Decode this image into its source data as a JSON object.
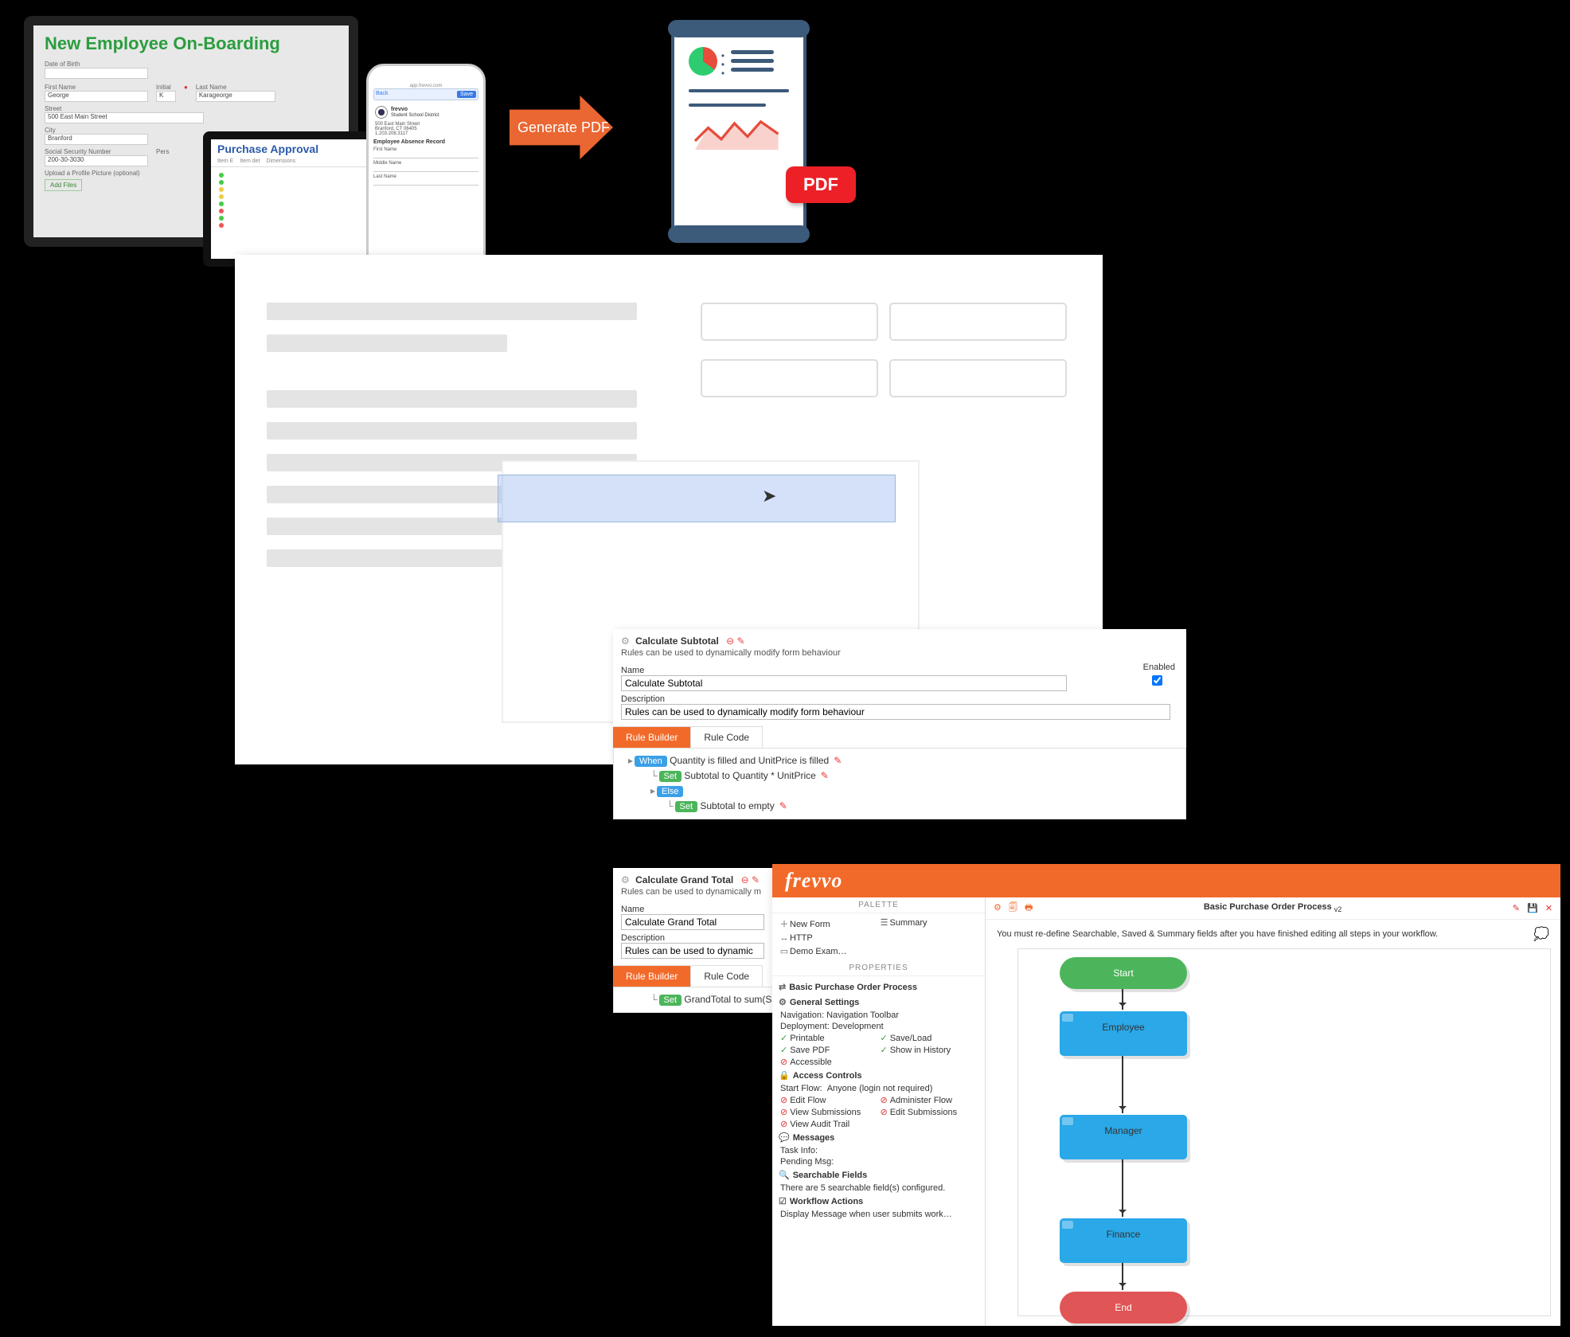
{
  "laptop": {
    "title": "New Employee On-Boarding",
    "dob_label": "Date of Birth",
    "first_name_label": "First Name",
    "first_name": "George",
    "initial_label": "Initial",
    "initial": "K",
    "last_name_label": "Last Name",
    "last_name": "Karageorge",
    "street_label": "Street",
    "street": "500 East Main Street",
    "city_label": "City",
    "city": "Branford",
    "ssn_label": "Social Security Number",
    "ssn": "200-30-3030",
    "pers_label": "Pers",
    "upload_label": "Upload a Profile Picture (optional)",
    "add_files": "Add Files"
  },
  "tablet": {
    "title": "Purchase Approval",
    "tabs": [
      "Item E",
      "Item det",
      "Dimensions"
    ]
  },
  "phone": {
    "back": "Back",
    "save": "Save",
    "url": "app.frevvo.com",
    "brand": "frevvo",
    "subtitle": "Student School District",
    "addr1": "500 East Main Street",
    "addr2": "Branford, CT 06405",
    "phonenum": "1.203.208.3117",
    "section": "Employee Absence Record",
    "fn": "First Name",
    "mn": "Middle Name",
    "ln": "Last Name"
  },
  "arrow_label": "Generate PDF",
  "pdf_badge": "PDF",
  "rule1": {
    "title": "Calculate Subtotal",
    "subtitle": "Rules can be used to dynamically modify form behaviour",
    "name_label": "Name",
    "name_value": "Calculate Subtotal",
    "desc_label": "Description",
    "desc_value": "Rules can be used to dynamically modify form behaviour",
    "enabled_label": "Enabled",
    "tab_builder": "Rule Builder",
    "tab_code": "Rule Code",
    "when_text": "Quantity is filled and UnitPrice is filled",
    "set1_text": "Subtotal to Quantity * UnitPrice",
    "else_text": "Else",
    "set2_text": "Subtotal to empty"
  },
  "rule2": {
    "title": "Calculate Grand Total",
    "subtitle": "Rules can be used to dynamically m",
    "name_label": "Name",
    "name_value": "Calculate Grand Total",
    "desc_label": "Description",
    "desc_value": "Rules can be used to dynamic",
    "tab_builder": "Rule Builder",
    "tab_code": "Rule Code",
    "set_text": "GrandTotal to sum(S"
  },
  "frevvo": {
    "logo": "frevvo",
    "palette_title": "PALETTE",
    "palette": {
      "new_form": "New Form",
      "summary": "Summary",
      "http": "HTTP",
      "demo": "Demo Exam…"
    },
    "properties_title": "PROPERTIES",
    "flow_name": "Basic Purchase Order Process",
    "general_settings": "General Settings",
    "nav_label": "Navigation:",
    "nav_value": "Navigation Toolbar",
    "deploy_label": "Deployment:",
    "deploy_value": "Development",
    "printable": "Printable",
    "saveload": "Save/Load",
    "savepdf": "Save PDF",
    "showhistory": "Show in History",
    "accessible": "Accessible",
    "access_controls": "Access Controls",
    "start_flow_label": "Start Flow:",
    "start_flow_value": "Anyone (login not required)",
    "edit_flow": "Edit Flow",
    "admin_flow": "Administer Flow",
    "view_subs": "View Submissions",
    "edit_subs": "Edit Submissions",
    "view_audit": "View Audit Trail",
    "messages": "Messages",
    "task_info": "Task Info:",
    "pending_msg": "Pending Msg:",
    "searchable": "Searchable Fields",
    "searchable_text": "There are 5 searchable field(s) configured.",
    "wf_actions": "Workflow Actions",
    "wf_action1": "Display Message when user submits work…",
    "title": "Basic Purchase Order Process",
    "title_ver": "v2",
    "notice": "You must re-define Searchable, Saved & Summary fields after you have finished editing all steps in your workflow.",
    "nodes": {
      "start": "Start",
      "employee": "Employee",
      "manager": "Manager",
      "finance": "Finance",
      "end": "End"
    }
  }
}
